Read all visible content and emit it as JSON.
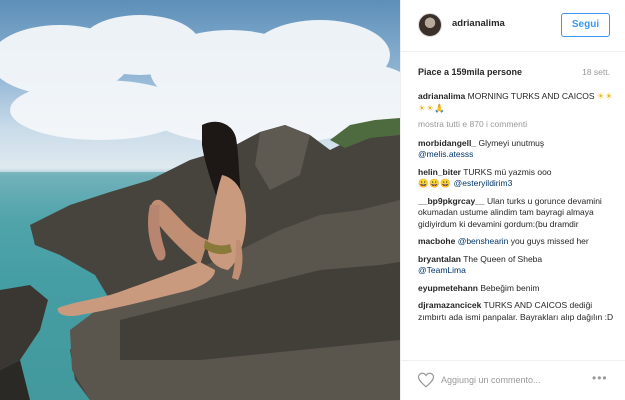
{
  "post": {
    "image_alt": "photo of woman sitting on rocks by the sea"
  },
  "header": {
    "username": "adrianalima",
    "follow_label": "Segui"
  },
  "stats": {
    "likes": "Piace a 159mila persone",
    "time": "18 sett."
  },
  "caption": {
    "user": "adrianalima",
    "text": "MORNING TURKS AND CAICOS",
    "emoji": "☀☀☀☀🙏"
  },
  "show_all": "mostra tutti e 870 i commenti",
  "comments": [
    {
      "user": "morbidangell_",
      "text": "Glymeyi unutmuş",
      "mention": "@melis.atesss",
      "after": ""
    },
    {
      "user": "helin_biter",
      "text": "TURKS mü yazmis ooo",
      "emoji": "😀😀😀",
      "mention": "@esteryildirim3",
      "after": ""
    },
    {
      "user": "__bp9pkgrcay__",
      "text": "Ulan turks u gorunce devamini okumadan ustume alindim tam bayragi almaya gidiyirdum ki devamini gordum:(bu dramdir",
      "mention": "",
      "after": ""
    },
    {
      "user": "macbohe",
      "text": "",
      "mention": "@benshearin",
      "after": "you guys missed her"
    },
    {
      "user": "bryantalan",
      "text": "The Queen of Sheba",
      "mention": "@TeamLima",
      "after": ""
    },
    {
      "user": "eyupmetehann",
      "text": "Bebeğim benim",
      "mention": "",
      "after": ""
    },
    {
      "user": "djramazancicek",
      "text": "TURKS AND CAICOS dediği zımbırtı ada ismi panpalar. Bayrakları alıp dağılın :D",
      "mention": "",
      "after": ""
    }
  ],
  "footer": {
    "placeholder": "Aggiungi un commento...",
    "more": "•••"
  }
}
